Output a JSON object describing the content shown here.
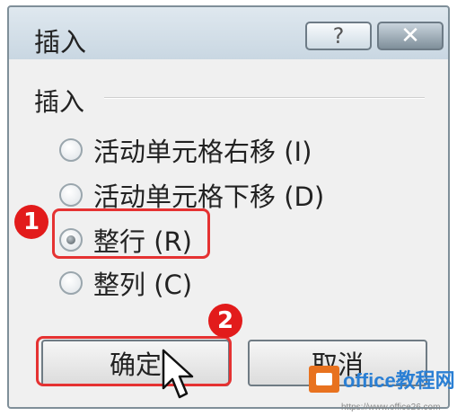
{
  "window": {
    "title": "插入",
    "help_glyph": "?",
    "close_glyph": "✕"
  },
  "group": {
    "label": "插入",
    "options": [
      {
        "label": "活动单元格右移 (I)",
        "checked": false
      },
      {
        "label": "活动单元格下移 (D)",
        "checked": false
      },
      {
        "label": "整行 (R)",
        "checked": true
      },
      {
        "label": "整列 (C)",
        "checked": false
      }
    ]
  },
  "buttons": {
    "ok_label": "确定",
    "cancel_label": "取消"
  },
  "annotations": {
    "step1": "1",
    "step2": "2",
    "highlight_color": "#e53232",
    "badge_color": "#e21b1b"
  },
  "watermark": {
    "brand": "office教程网",
    "url": "https://www.office26.com"
  }
}
